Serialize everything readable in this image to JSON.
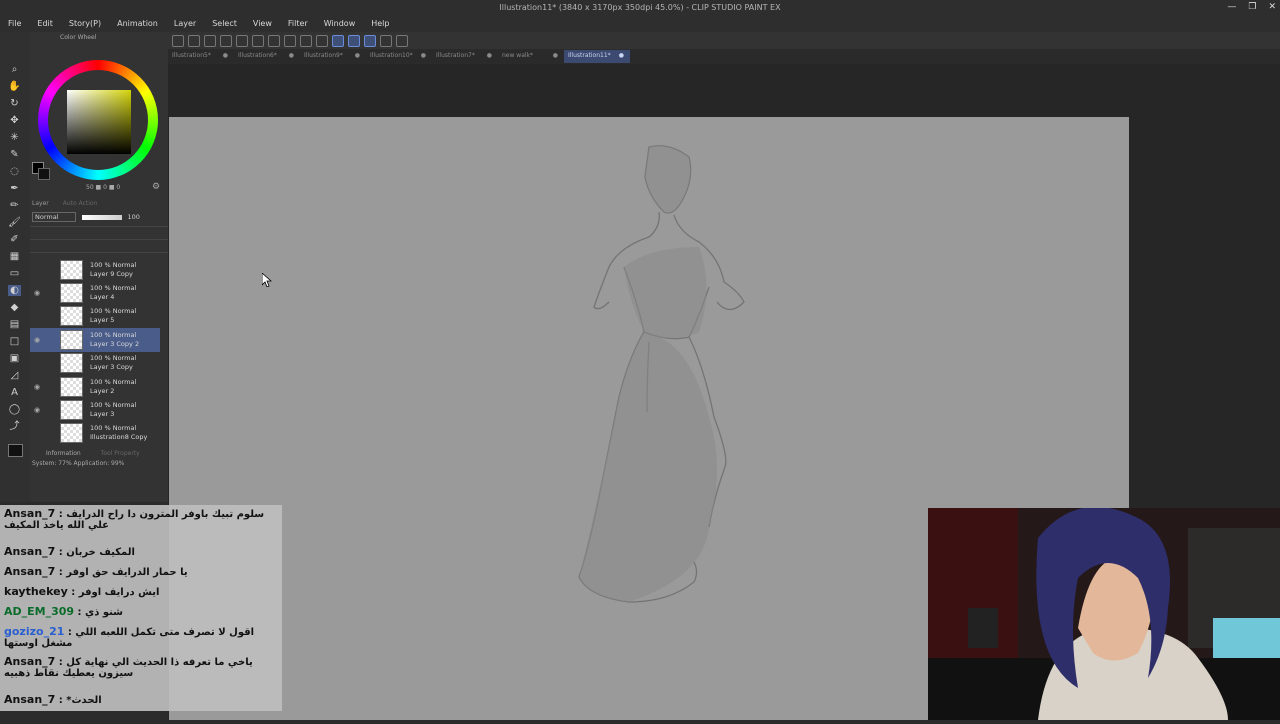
{
  "window": {
    "title": "Illustration11* (3840 x 3170px 350dpi 45.0%) - CLIP STUDIO PAINT EX",
    "buttons": [
      "—",
      "❐",
      "✕"
    ]
  },
  "menu": [
    "File",
    "Edit",
    "Story(P)",
    "Animation",
    "Layer",
    "Select",
    "View",
    "Filter",
    "Window",
    "Help"
  ],
  "tabs": [
    {
      "label": "Illustration5*",
      "active": false
    },
    {
      "label": "Illustration6*",
      "active": false
    },
    {
      "label": "Illustration9*",
      "active": false
    },
    {
      "label": "Illustration10*",
      "active": false
    },
    {
      "label": "Illustration7*",
      "active": false
    },
    {
      "label": "new walk*",
      "active": false
    },
    {
      "label": "Illustration11*",
      "active": true
    }
  ],
  "color_panel": {
    "title": "Color Wheel",
    "values": "50 ■ 0 ■ 0"
  },
  "layer_panel": {
    "tab_layer": "Layer",
    "tab_other": "Auto Action",
    "blend_mode": "Normal",
    "opacity": "100",
    "layers": [
      {
        "mode": "100 % Normal",
        "name": "Layer 9 Copy",
        "selected": false
      },
      {
        "mode": "100 % Normal",
        "name": "Layer 4",
        "selected": false
      },
      {
        "mode": "100 % Normal",
        "name": "Layer 5",
        "selected": false
      },
      {
        "mode": "100 % Normal",
        "name": "Layer 3 Copy 2",
        "selected": true
      },
      {
        "mode": "100 % Normal",
        "name": "Layer 3 Copy",
        "selected": false
      },
      {
        "mode": "100 % Normal",
        "name": "Layer 2",
        "selected": false
      },
      {
        "mode": "100 % Normal",
        "name": "Layer 3",
        "selected": false
      },
      {
        "mode": "100 % Normal",
        "name": "Illustration8 Copy",
        "selected": false
      }
    ]
  },
  "info_panel": {
    "title": "Information",
    "tab2": "Tool Property",
    "system": "System: 77%  Application: 99%"
  },
  "chat": [
    {
      "user": "Ansan_7",
      "message": "سلوم تبيك باوفر المترون دا راح الدرايف علي الله ياخذ المكيف"
    },
    {
      "user": "Ansan_7",
      "message": "المكيف خربان"
    },
    {
      "user": "Ansan_7",
      "message": "يا حمار الدرايف حق اوفر"
    },
    {
      "user": "kaythekey",
      "message": "ايش درايف اوفر"
    },
    {
      "user": "AD_EM_309",
      "message": "شنو ذي"
    },
    {
      "user": "gozizo_21",
      "message": "اقول لا تصرف متى تكمل اللعبه اللي مشغل اوستها"
    },
    {
      "user": "Ansan_7",
      "message": "ياخي ما تعرفه ذا الحديث الي نهاية كل سيزون يعطيك نقاط ذهبيه"
    },
    {
      "user": "Ansan_7",
      "message": "الحدث*"
    }
  ],
  "colors": {
    "canvas": "#9a9a9a",
    "selected_layer": "#4a5c8a",
    "active_tab": "#3c4a72"
  }
}
